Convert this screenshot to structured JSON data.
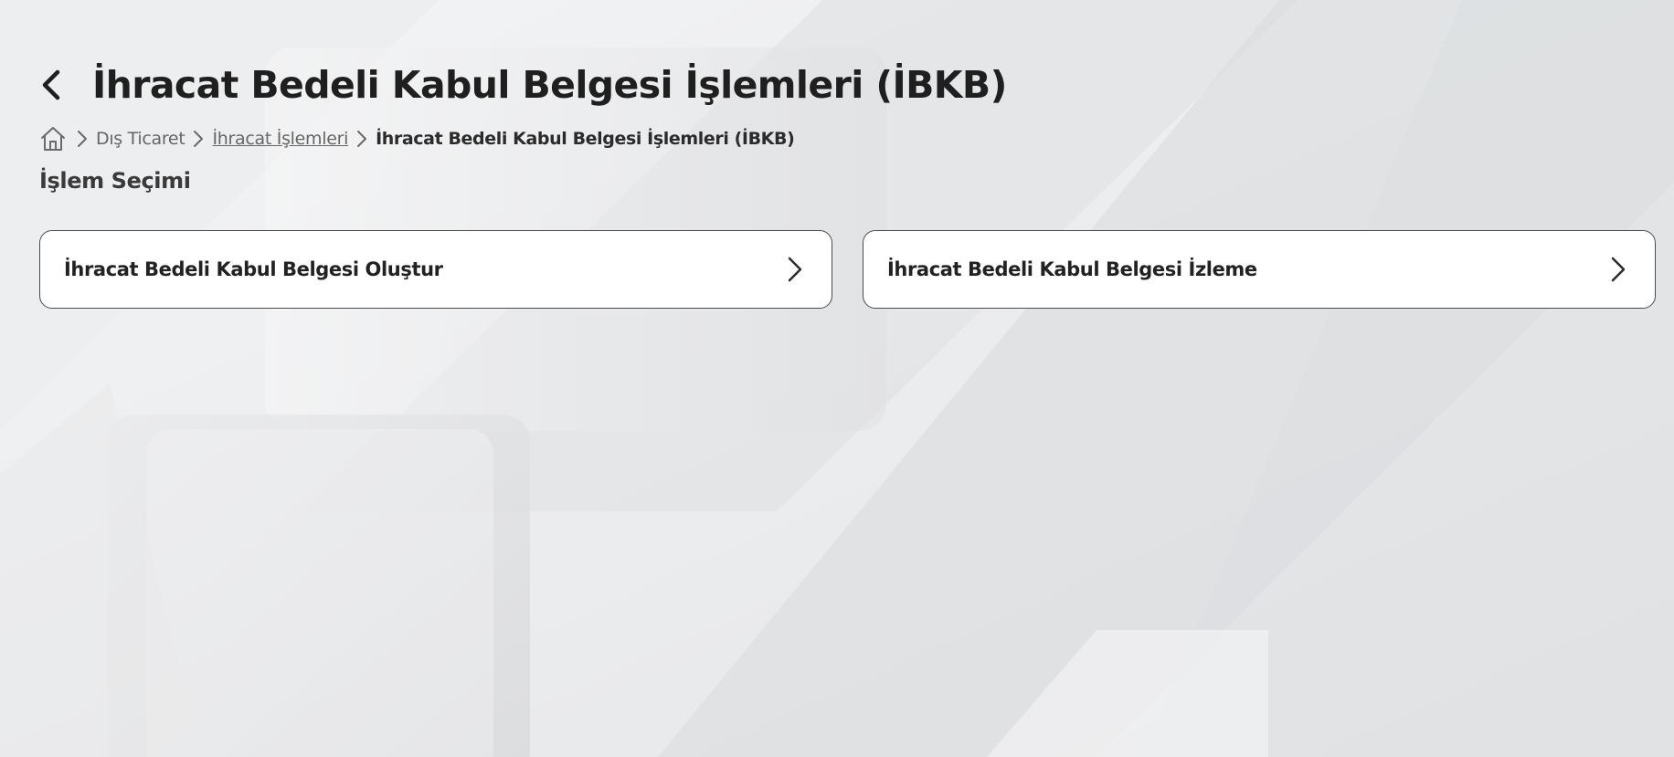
{
  "header": {
    "title": "İhracat Bedeli Kabul Belgesi İşlemleri (İBKB)",
    "back_icon": "chevron-left-icon"
  },
  "breadcrumb": {
    "home_icon": "home-icon",
    "separator_icon": "chevron-right-icon",
    "items": [
      {
        "label": "Dış Ticaret",
        "underlined": false
      },
      {
        "label": "İhracat İşlemleri",
        "underlined": true
      },
      {
        "label": "İhracat Bedeli Kabul Belgesi İşlemleri (İBKB)",
        "current": true
      }
    ]
  },
  "section": {
    "label": "İşlem Seçimi"
  },
  "cards": [
    {
      "label": "İhracat Bedeli Kabul Belgesi Oluştur",
      "icon": "chevron-right-icon"
    },
    {
      "label": "İhracat Bedeli Kabul Belgesi İzleme",
      "icon": "chevron-right-icon"
    }
  ],
  "colors": {
    "text_primary": "#1f1f1f",
    "text_muted": "#666666",
    "card_border": "#4a4a4a",
    "card_bg": "#ffffff",
    "background": "#e6e7e9"
  }
}
